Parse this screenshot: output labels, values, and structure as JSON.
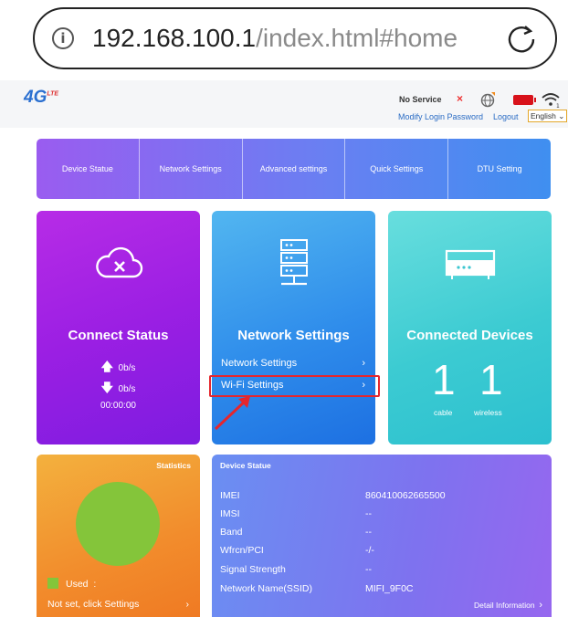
{
  "browser": {
    "url_host": "192.168.100.1",
    "url_path": "/index.html#home"
  },
  "header": {
    "logo_main": "4G",
    "logo_sub": "LTE",
    "status": "No Service",
    "modify_password": "Modify Login Password",
    "logout": "Logout",
    "language": "English"
  },
  "nav_tabs": [
    {
      "label": "Device Statue"
    },
    {
      "label": "Network Settings"
    },
    {
      "label": "Advanced settings"
    },
    {
      "label": "Quick Settings"
    },
    {
      "label": "DTU Setting"
    }
  ],
  "connect_card": {
    "title": "Connect Status",
    "upload": "0b/s",
    "download": "0b/s",
    "duration": "00:00:00"
  },
  "network_card": {
    "title": "Network Settings",
    "links": [
      {
        "label": "Network Settings"
      },
      {
        "label": "Wi-Fi Settings"
      }
    ]
  },
  "devices_card": {
    "title": "Connected Devices",
    "cable_count": "1",
    "wireless_count": "1",
    "cable_label": "cable",
    "wireless_label": "wireless"
  },
  "stats_card": {
    "title": "Statistics",
    "legend": "Used",
    "legend_sep": ":",
    "not_set": "Not set, click Settings"
  },
  "device_status": {
    "title": "Device Statue",
    "rows": [
      {
        "label": "IMEI",
        "value": "860410062665500"
      },
      {
        "label": "IMSI",
        "value": "--"
      },
      {
        "label": "Band",
        "value": "--"
      },
      {
        "label": "Wfrcn/PCI",
        "value": "-/-"
      },
      {
        "label": "Signal Strength",
        "value": "--"
      },
      {
        "label": "Network Name(SSID)",
        "value": "MIFI_9F0C"
      }
    ],
    "detail_link": "Detail Information"
  },
  "colors": {
    "accent_red": "#e5262d",
    "used_green": "#84c53a"
  }
}
